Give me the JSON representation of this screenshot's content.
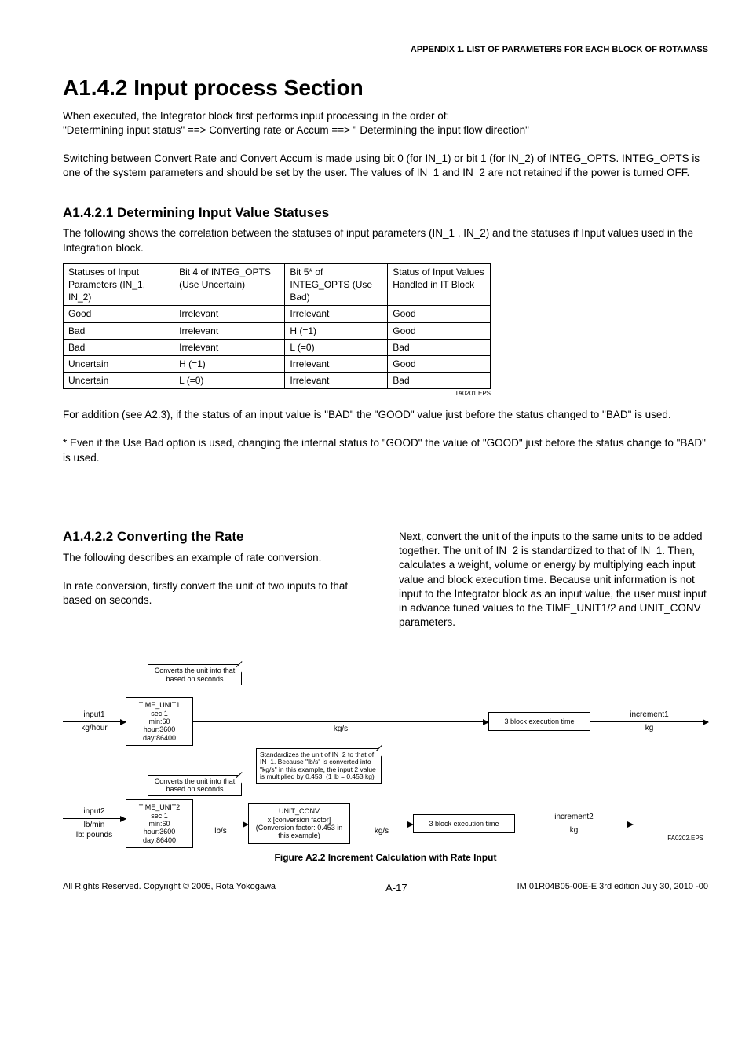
{
  "header": {
    "appendix": "APPENDIX 1.  LIST OF PARAMETERS FOR EACH BLOCK OF ROTAMASS"
  },
  "section": {
    "title": "A1.4.2 Input process Section",
    "intro1": "When executed, the Integrator block first performs input processing in the order of:",
    "intro2": "\"Determining input status\" ==> Converting rate or Accum ==> \" Determining the input flow direction\"",
    "intro3": "Switching between Convert Rate and Convert Accum is made using bit 0 (for IN_1) or bit 1 (for IN_2) of INTEG_OPTS. INTEG_OPTS is one of the system parameters and should be set by the user. The values of IN_1 and IN_2 are not retained if the power is turned OFF."
  },
  "sub1": {
    "title": "A1.4.2.1 Determining Input Value Statuses",
    "intro": "The following shows the correlation between the statuses of input parameters (IN_1 , IN_2) and the statuses if Input values used in the Integration block.",
    "table": {
      "headers": [
        "Statuses of Input Parameters (IN_1, IN_2)",
        "Bit 4 of INTEG_OPTS (Use Uncertain)",
        "Bit 5* of INTEG_OPTS (Use Bad)",
        "Status of Input Values Handled in IT Block"
      ],
      "rows": [
        [
          "Good",
          "Irrelevant",
          "Irrelevant",
          "Good"
        ],
        [
          "Bad",
          "Irrelevant",
          "H (=1)",
          "Good"
        ],
        [
          "Bad",
          "Irrelevant",
          "L (=0)",
          "Bad"
        ],
        [
          "Uncertain",
          "H (=1)",
          "Irrelevant",
          "Good"
        ],
        [
          "Uncertain",
          "L (=0)",
          "Irrelevant",
          "Bad"
        ]
      ],
      "eps": "TA0201.EPS"
    },
    "after1": "For addition (see A2.3), if the status of an input value is \"BAD\" the \"GOOD\" value just before the status changed to \"BAD\" is used.",
    "after2": "* Even if the Use Bad option is used, changing the internal status to \"GOOD\" the value of \"GOOD\" just before the status change to \"BAD\" is used."
  },
  "sub2": {
    "title": "A1.4.2.2 Converting the Rate",
    "left1": "The following describes an example of rate conversion.",
    "left2": "In rate conversion, firstly convert the unit of two inputs to that based on seconds.",
    "right": "Next, convert the unit of the inputs to the same units to be added together. The unit of IN_2 is standardized to that of IN_1. Then, calculates a weight, volume or energy by multiplying each input value and block execution time. Because unit information is not input to the Integrator block as an input value, the user must input in advance tuned values to the TIME_UNIT1/2 and UNIT_CONV parameters."
  },
  "figure": {
    "convNote": "Converts the unit into that based on seconds",
    "stdNote": "Standardizes the unit of IN_2 to that of IN_1. Because \"lb/s\" is converted into \"kg/s\" in this example, the input 2 value is multiplied by 0.453. (1 lb = 0.453 kg)",
    "time_unit1_title": "TIME_UNIT1",
    "time_unit2_title": "TIME_UNIT2",
    "time_unit_body": "sec:1\nmin:60\nhour:3600\nday:86400",
    "unit_conv_title": "UNIT_CONV",
    "unit_conv_body": "x [conversion factor]\n(Conversion factor: 0.453 in this example)",
    "input1_top": "input1",
    "input1_bot": "kg/hour",
    "input2_top": "input2",
    "input2_bot": "lb/min\nlb: pounds",
    "mid1": "kg/s",
    "mid2a": "lb/s",
    "mid2b": "kg/s",
    "exec": "3 block execution time",
    "inc1_top": "increment1",
    "inc1_bot": "kg",
    "inc2_top": "increment2",
    "inc2_bot": "kg",
    "caption": "Figure  A2.2  Increment Calculation with Rate Input",
    "eps": "FA0202.EPS"
  },
  "footer": {
    "left": "All Rights Reserved. Copyright © 2005, Rota Yokogawa",
    "center": "A-17",
    "right": "IM 01R04B05-00E-E    3rd edition July 30, 2010 -00"
  }
}
